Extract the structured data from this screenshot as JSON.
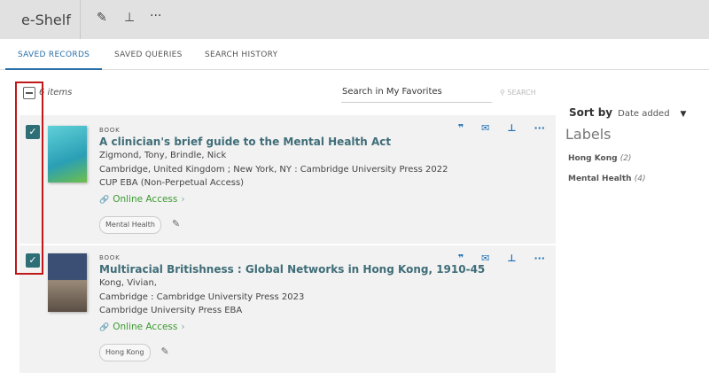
{
  "header": {
    "title": "e-Shelf",
    "icons": [
      "pencil-icon",
      "unpin-icon",
      "more-icon"
    ]
  },
  "tabs": [
    "SAVED RECORDS",
    "SAVED QUERIES",
    "SEARCH HISTORY"
  ],
  "toolbar": {
    "items_count": "6 items",
    "search_placeholder": "Search in My Favorites",
    "search_label": "SEARCH"
  },
  "records": [
    {
      "type": "BOOK",
      "title": "A clinician's brief guide to the Mental Health Act",
      "authors": "Zigmond, Tony, Brindle, Nick",
      "publisher": "Cambridge, United Kingdom ; New York, NY : Cambridge University Press 2022",
      "collection": "CUP EBA (Non-Perpetual Access)",
      "access": "Online Access",
      "label": "Mental Health",
      "checked": true,
      "cover_color": "#3fb7c8"
    },
    {
      "type": "BOOK",
      "title": "Multiracial Britishness : Global Networks in Hong Kong, 1910-45",
      "authors": "Kong, Vivian,",
      "publisher": "Cambridge : Cambridge University Press 2023",
      "collection": "Cambridge University Press EBA",
      "access": "Online Access",
      "label": "Hong Kong",
      "checked": true,
      "cover_color": "#3a4f73"
    }
  ],
  "sidebar": {
    "sort_label": "Sort by",
    "sort_value": "Date added",
    "labels_title": "Labels",
    "labels": [
      {
        "name": "Hong Kong",
        "count": "(2)"
      },
      {
        "name": "Mental Health",
        "count": "(4)"
      }
    ]
  },
  "colors": {
    "accent": "#2a6fa8",
    "title": "#3f6d78",
    "online": "#3a9a2e",
    "highlight": "#c01818"
  }
}
